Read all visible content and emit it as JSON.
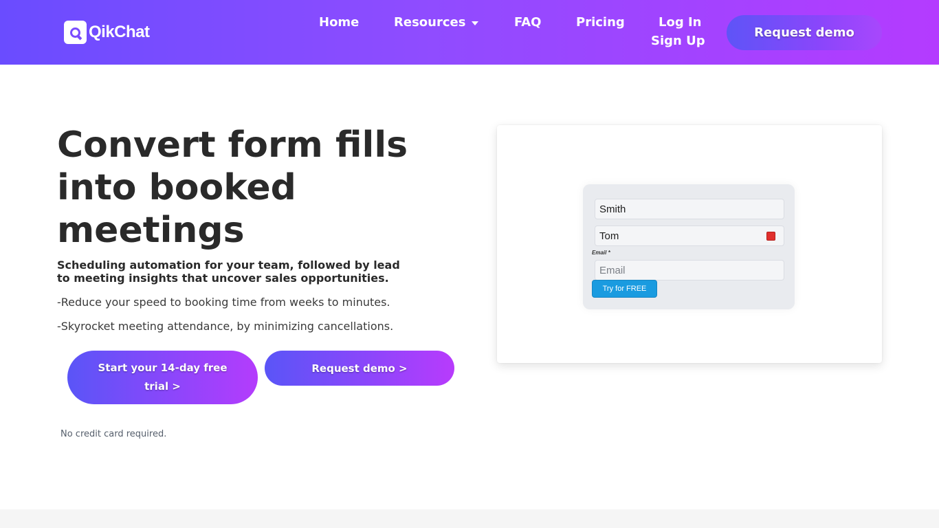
{
  "header": {
    "logo_text": "QikChat",
    "nav": {
      "home": "Home",
      "resources": "Resources",
      "faq": "FAQ",
      "pricing": "Pricing",
      "login": "Log In",
      "signup": "Sign Up"
    },
    "cta": "Request demo"
  },
  "hero": {
    "title": "Convert form fills into booked meetings",
    "subtitle": "Scheduling automation for your team, followed by lead to meeting insights that uncover sales opportunities.",
    "bullets": [
      "-Reduce your speed to booking time from weeks to minutes.",
      "-Skyrocket meeting attendance, by minimizing cancellations."
    ],
    "primary_cta": "Start your 14-day free trial >",
    "secondary_cta": "Request demo >",
    "note": "No credit card required."
  },
  "preview_form": {
    "last_name_value": "Smith",
    "first_name_value": "Tom",
    "email_label": "Email *",
    "email_placeholder": "Email",
    "submit_label": "Try for FREE"
  },
  "colors": {
    "header_gradient_start": "#6a4cff",
    "header_gradient_end": "#b43bff",
    "button_gradient_start": "#5a55f7",
    "button_gradient_end": "#b43cfc",
    "form_submit": "#1a9be0"
  },
  "icons": [
    "logo-mark-icon",
    "caret-down-icon",
    "autofill-icon"
  ]
}
